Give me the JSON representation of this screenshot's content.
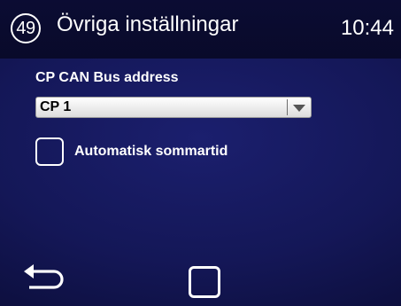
{
  "header": {
    "page_number": "49",
    "title": "Övriga inställningar",
    "time": "10:44"
  },
  "settings": {
    "can_bus_label": "CP CAN Bus address",
    "can_bus_value": "CP  1",
    "auto_dst_label": "Automatisk sommartid",
    "auto_dst_checked": false
  },
  "nav": {
    "back_icon": "back-arrow",
    "home_icon": "square"
  }
}
